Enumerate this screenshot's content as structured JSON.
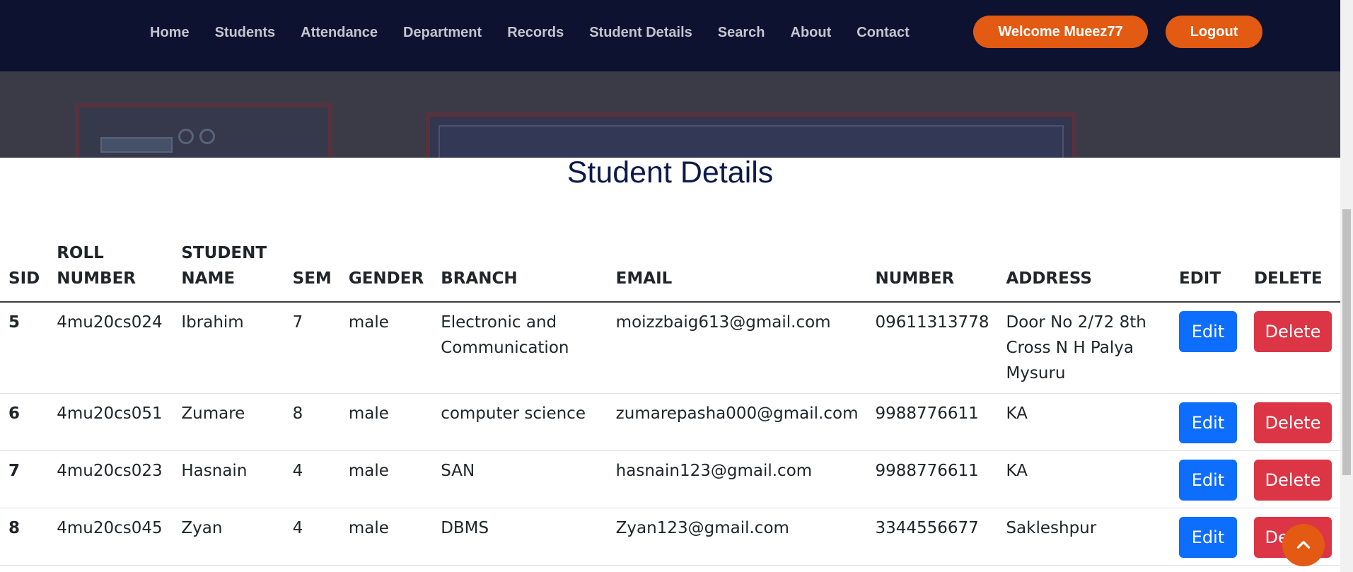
{
  "nav": {
    "links": [
      "Home",
      "Students",
      "Attendance",
      "Department",
      "Records",
      "Student Details",
      "Search",
      "About",
      "Contact"
    ],
    "welcome": "Welcome Mueez77",
    "logout": "Logout"
  },
  "page": {
    "title": "Student Details"
  },
  "table": {
    "headers": {
      "sid": "SID",
      "roll": "ROLL NUMBER",
      "name": "STUDENT NAME",
      "sem": "SEM",
      "gender": "GENDER",
      "branch": "BRANCH",
      "email": "EMAIL",
      "number": "NUMBER",
      "address": "ADDRESS",
      "edit": "EDIT",
      "delete": "DELETE"
    },
    "rows": [
      {
        "sid": "5",
        "roll": "4mu20cs024",
        "name": "Ibrahim",
        "sem": "7",
        "gender": "male",
        "branch": "Electronic and Communication",
        "email": "moizzbaig613@gmail.com",
        "number": "09611313778",
        "address": "Door No 2/72 8th Cross N H Palya Mysuru"
      },
      {
        "sid": "6",
        "roll": "4mu20cs051",
        "name": "Zumare",
        "sem": "8",
        "gender": "male",
        "branch": "computer science",
        "email": "zumarepasha000@gmail.com",
        "number": "9988776611",
        "address": "KA"
      },
      {
        "sid": "7",
        "roll": "4mu20cs023",
        "name": "Hasnain",
        "sem": "4",
        "gender": "male",
        "branch": "SAN",
        "email": "hasnain123@gmail.com",
        "number": "9988776611",
        "address": "KA"
      },
      {
        "sid": "8",
        "roll": "4mu20cs045",
        "name": "Zyan",
        "sem": "4",
        "gender": "male",
        "branch": "DBMS",
        "email": "Zyan123@gmail.com",
        "number": "3344556677",
        "address": "Sakleshpur"
      }
    ],
    "edit_label": "Edit",
    "delete_label": "Delete"
  },
  "icons": {
    "to_top": "chevron-up-icon"
  },
  "colors": {
    "navbar": "#0c1230",
    "accent": "#e35a12",
    "edit": "#0d6efd",
    "delete": "#dc3545",
    "title": "#0c1a4a"
  }
}
